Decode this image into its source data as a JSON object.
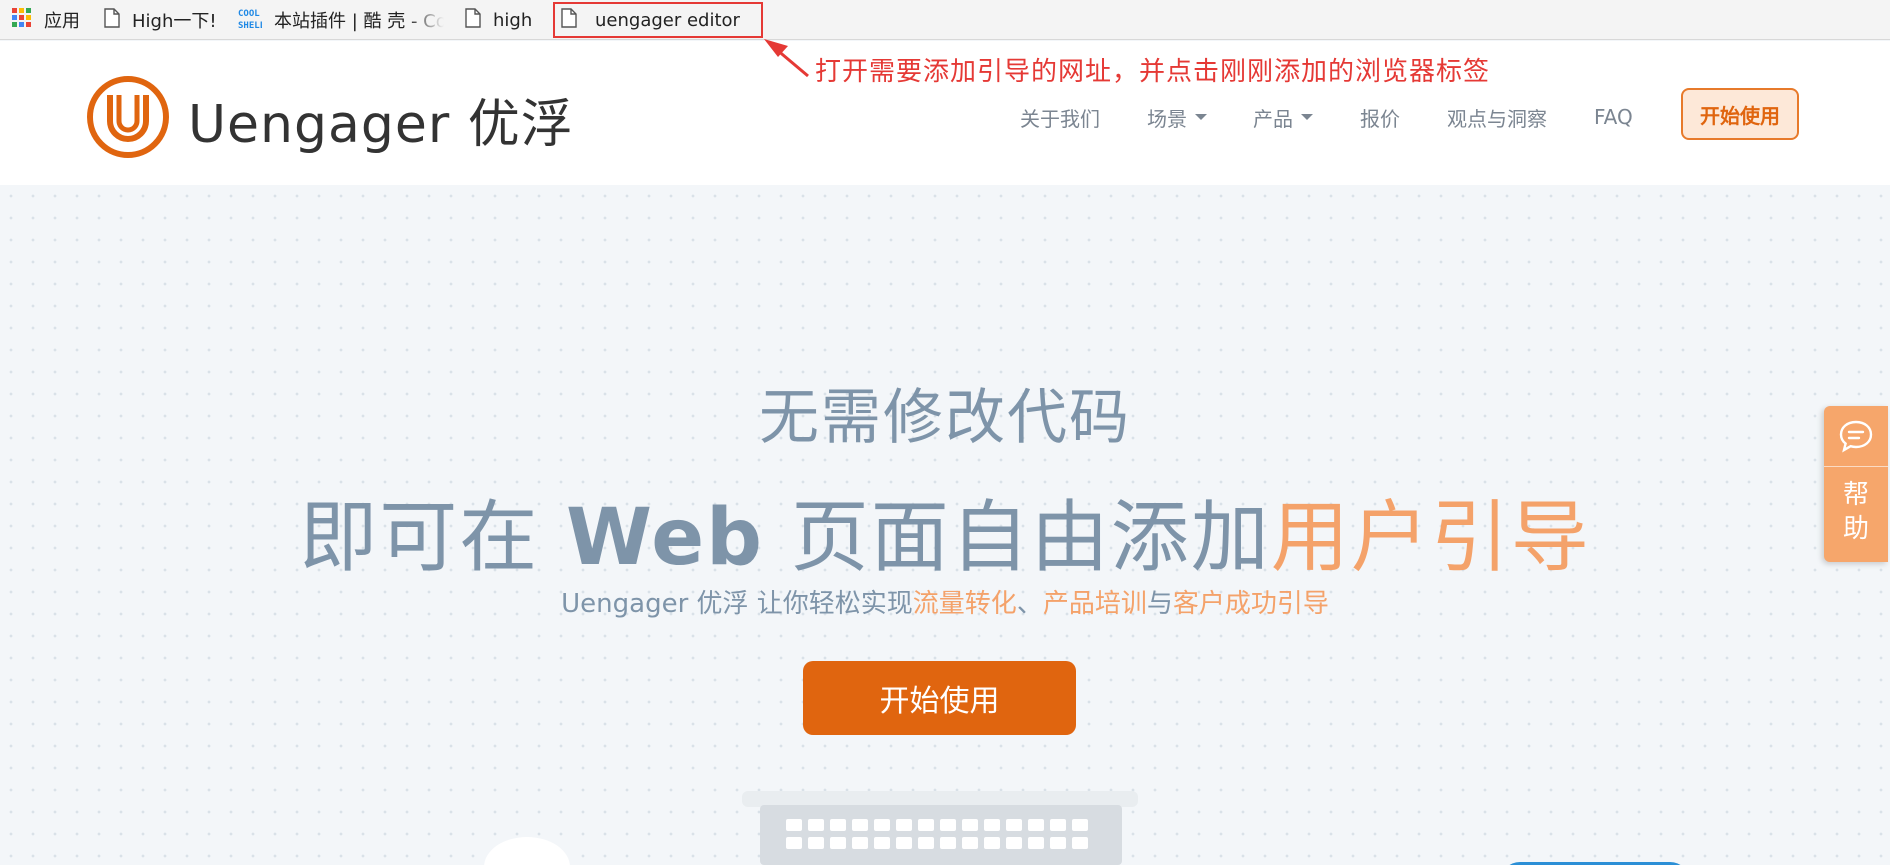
{
  "bookmarks": {
    "apps": {
      "label": "应用",
      "icon": "apps-grid-icon"
    },
    "items": [
      {
        "label": "High一下!",
        "icon": "page-icon"
      },
      {
        "label": "本站插件 | 酷 壳 - Co",
        "icon": "coolshell-icon"
      },
      {
        "label": "high",
        "icon": "page-icon"
      },
      {
        "label": "uengager editor",
        "icon": "page-icon"
      }
    ]
  },
  "annotation": {
    "text": "打开需要添加引导的网址，并点击刚刚添加的浏览器标签",
    "color": "#e53935"
  },
  "header": {
    "logo_text": "Uengager 优浮",
    "nav": [
      {
        "label": "关于我们",
        "dropdown": false
      },
      {
        "label": "场景",
        "dropdown": true
      },
      {
        "label": "产品",
        "dropdown": true
      },
      {
        "label": "报价",
        "dropdown": false
      },
      {
        "label": "观点与洞察",
        "dropdown": false
      },
      {
        "label": "FAQ",
        "dropdown": false
      }
    ],
    "cta_label": "开始使用"
  },
  "hero": {
    "line1": "无需修改代码",
    "line2_prefix": "即可在 ",
    "line2_web": "Web",
    "line2_mid": " 页面自由添加",
    "line2_highlight": "用户引导",
    "line3_prefix": "Uengager 优浮 让你轻松实现",
    "line3_h1": "流量转化",
    "line3_sep": "、",
    "line3_h2": "产品培训",
    "line3_and": "与",
    "line3_h3": "客户成功引导",
    "cta_label": "开始使用"
  },
  "help_widget": {
    "label_1": "帮",
    "label_2": "助",
    "icon": "chat-bubble-icon"
  },
  "colors": {
    "brand_orange": "#e0650f",
    "highlight_orange": "#f4a26a",
    "text_blue_gray": "#7e94a9"
  }
}
